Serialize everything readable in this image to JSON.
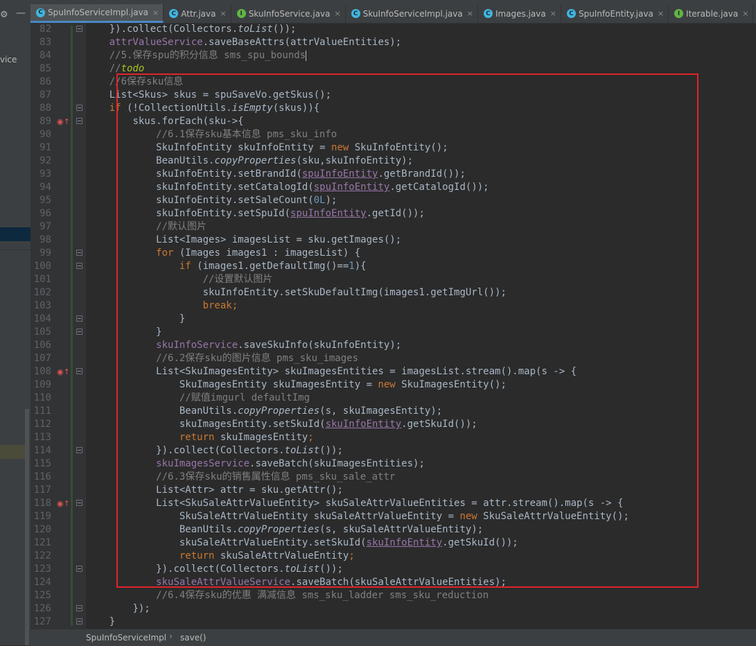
{
  "sidebar": {
    "visible_text": "vice"
  },
  "tabs": [
    {
      "label": "SpuInfoServiceImpl.java",
      "icon": "class-icon",
      "active": true,
      "closable": true
    },
    {
      "label": "Attr.java",
      "icon": "class-icon",
      "active": false,
      "closable": true
    },
    {
      "label": "SkuInfoService.java",
      "icon": "interface-icon",
      "active": false,
      "closable": true
    },
    {
      "label": "SkuInfoServiceImpl.java",
      "icon": "class-icon",
      "active": false,
      "closable": true
    },
    {
      "label": "Images.java",
      "icon": "class-icon",
      "active": false,
      "closable": true
    },
    {
      "label": "SpuInfoEntity.java",
      "icon": "class-icon",
      "active": false,
      "closable": true
    },
    {
      "label": "Iterable.java",
      "icon": "interface-icon",
      "active": false,
      "closable": true
    }
  ],
  "editor": {
    "lines": [
      {
        "n": "82",
        "indent": 4,
        "fold": true,
        "tokens": [
          [
            "}).collect(Collectors.",
            ""
          ],
          [
            "toList",
            "it"
          ],
          [
            "());",
            ""
          ]
        ]
      },
      {
        "n": "83",
        "indent": 4,
        "tokens": [
          [
            "attrValueService",
            "field"
          ],
          [
            ".saveBaseAttrs(attrValueEntities);",
            ""
          ]
        ]
      },
      {
        "n": "84",
        "indent": 4,
        "caret": true,
        "tokens": [
          [
            "//5.保存spu的积分信息 sms_spu_bounds",
            "cm"
          ]
        ]
      },
      {
        "n": "85",
        "indent": 4,
        "tokens": [
          [
            "//",
            "cm"
          ],
          [
            "todo",
            "todo"
          ]
        ]
      },
      {
        "n": "86",
        "indent": 4,
        "tokens": [
          [
            "//6保存sku信息",
            "cm"
          ]
        ]
      },
      {
        "n": "87",
        "indent": 4,
        "tokens": [
          [
            "List<Skus> skus = spuSaveVo.getSkus();",
            ""
          ]
        ]
      },
      {
        "n": "88",
        "indent": 4,
        "fold": true,
        "tokens": [
          [
            "if",
            "kw"
          ],
          [
            " (!CollectionUtils.",
            ""
          ],
          [
            "isEmpty",
            "it"
          ],
          [
            "(skus)){",
            ""
          ]
        ]
      },
      {
        "n": "89",
        "indent": 8,
        "icon": true,
        "fold": true,
        "tokens": [
          [
            "skus.forEach(sku->{",
            ""
          ]
        ]
      },
      {
        "n": "90",
        "indent": 12,
        "tokens": [
          [
            "//6.1保存sku基本信息 pms_sku_info",
            "cm"
          ]
        ]
      },
      {
        "n": "91",
        "indent": 12,
        "tokens": [
          [
            "SkuInfoEntity skuInfoEntity = ",
            ""
          ],
          [
            "new",
            "kw"
          ],
          [
            " SkuInfoEntity();",
            ""
          ]
        ]
      },
      {
        "n": "92",
        "indent": 12,
        "tokens": [
          [
            "BeanUtils.",
            ""
          ],
          [
            "copyProperties",
            "it"
          ],
          [
            "(sku,skuInfoEntity);",
            ""
          ]
        ]
      },
      {
        "n": "93",
        "indent": 12,
        "tokens": [
          [
            "skuInfoEntity.setBrandId(",
            ""
          ],
          [
            "spuInfoEntity",
            "ful"
          ],
          [
            ".getBrandId());",
            ""
          ]
        ]
      },
      {
        "n": "94",
        "indent": 12,
        "tokens": [
          [
            "skuInfoEntity.setCatalogId(",
            ""
          ],
          [
            "spuInfoEntity",
            "ful"
          ],
          [
            ".getCatalogId());",
            ""
          ]
        ]
      },
      {
        "n": "95",
        "indent": 12,
        "tokens": [
          [
            "skuInfoEntity.setSaleCount(",
            ""
          ],
          [
            "0L",
            "num"
          ],
          [
            ");",
            ""
          ]
        ]
      },
      {
        "n": "96",
        "indent": 12,
        "tokens": [
          [
            "skuInfoEntity.setSpuId(",
            ""
          ],
          [
            "spuInfoEntity",
            "ful"
          ],
          [
            ".getId());",
            ""
          ]
        ]
      },
      {
        "n": "97",
        "indent": 12,
        "tokens": [
          [
            "//默认图片",
            "cm"
          ]
        ]
      },
      {
        "n": "98",
        "indent": 12,
        "tokens": [
          [
            "List<Images> imagesList = sku.getImages();",
            ""
          ]
        ]
      },
      {
        "n": "99",
        "indent": 12,
        "fold": true,
        "tokens": [
          [
            "for",
            "kw"
          ],
          [
            " (Images images1 : imagesList) {",
            ""
          ]
        ]
      },
      {
        "n": "100",
        "indent": 16,
        "fold": true,
        "tokens": [
          [
            "if",
            "kw"
          ],
          [
            " (images1.getDefaultImg()==",
            ""
          ],
          [
            "1",
            "num"
          ],
          [
            "){",
            ""
          ]
        ]
      },
      {
        "n": "101",
        "indent": 20,
        "tokens": [
          [
            "//设置默认图片",
            "cm"
          ]
        ]
      },
      {
        "n": "102",
        "indent": 20,
        "tokens": [
          [
            "skuInfoEntity.setSkuDefaultImg(images1.getImgUrl());",
            ""
          ]
        ]
      },
      {
        "n": "103",
        "indent": 20,
        "tokens": [
          [
            "break;",
            "kw"
          ]
        ]
      },
      {
        "n": "104",
        "indent": 16,
        "fold": true,
        "tokens": [
          [
            "}",
            ""
          ]
        ]
      },
      {
        "n": "105",
        "indent": 12,
        "fold": true,
        "tokens": [
          [
            "}",
            ""
          ]
        ]
      },
      {
        "n": "106",
        "indent": 12,
        "tokens": [
          [
            "skuInfoService",
            "field"
          ],
          [
            ".saveSkuInfo(skuInfoEntity);",
            ""
          ]
        ]
      },
      {
        "n": "107",
        "indent": 12,
        "tokens": [
          [
            "//6.2保存sku的图片信息 pms_sku_images",
            "cm"
          ]
        ]
      },
      {
        "n": "108",
        "indent": 12,
        "icon": true,
        "fold": true,
        "tokens": [
          [
            "List<SkuImagesEntity> skuImagesEntities = imagesList.stream().map(s -> {",
            ""
          ]
        ]
      },
      {
        "n": "109",
        "indent": 16,
        "tokens": [
          [
            "SkuImagesEntity skuImagesEntity = ",
            ""
          ],
          [
            "new",
            "kw"
          ],
          [
            " SkuImagesEntity();",
            ""
          ]
        ]
      },
      {
        "n": "110",
        "indent": 16,
        "tokens": [
          [
            "//赋值imgurl defaultImg",
            "cm"
          ]
        ]
      },
      {
        "n": "111",
        "indent": 16,
        "tokens": [
          [
            "BeanUtils.",
            ""
          ],
          [
            "copyProperties",
            "it"
          ],
          [
            "(s, skuImagesEntity);",
            ""
          ]
        ]
      },
      {
        "n": "112",
        "indent": 16,
        "tokens": [
          [
            "skuImagesEntity.setSkuId(",
            ""
          ],
          [
            "skuInfoEntity",
            "ful"
          ],
          [
            ".getSkuId());",
            ""
          ]
        ]
      },
      {
        "n": "113",
        "indent": 16,
        "tokens": [
          [
            "return",
            "kw"
          ],
          [
            " skuImagesEntity",
            ""
          ],
          [
            ";",
            "kw"
          ]
        ]
      },
      {
        "n": "114",
        "indent": 12,
        "fold": true,
        "tokens": [
          [
            "}).collect(Collectors.",
            ""
          ],
          [
            "toList",
            "it"
          ],
          [
            "());",
            ""
          ]
        ]
      },
      {
        "n": "115",
        "indent": 12,
        "tokens": [
          [
            "skuImagesService",
            "field"
          ],
          [
            ".saveBatch(skuImagesEntities);",
            ""
          ]
        ]
      },
      {
        "n": "116",
        "indent": 12,
        "tokens": [
          [
            "//6.3保存sku的销售属性信息 pms_sku_sale_attr",
            "cm"
          ]
        ]
      },
      {
        "n": "117",
        "indent": 12,
        "tokens": [
          [
            "List<Attr> attr = sku.getAttr();",
            ""
          ]
        ]
      },
      {
        "n": "118",
        "indent": 12,
        "icon": true,
        "fold": true,
        "tokens": [
          [
            "List<SkuSaleAttrValueEntity> skuSaleAttrValueEntities = attr.stream().map(s -> {",
            ""
          ]
        ]
      },
      {
        "n": "119",
        "indent": 16,
        "tokens": [
          [
            "SkuSaleAttrValueEntity skuSaleAttrValueEntity = ",
            ""
          ],
          [
            "new",
            "kw"
          ],
          [
            " SkuSaleAttrValueEntity();",
            ""
          ]
        ]
      },
      {
        "n": "120",
        "indent": 16,
        "tokens": [
          [
            "BeanUtils.",
            ""
          ],
          [
            "copyProperties",
            "it"
          ],
          [
            "(s, skuSaleAttrValueEntity);",
            ""
          ]
        ]
      },
      {
        "n": "121",
        "indent": 16,
        "tokens": [
          [
            "skuSaleAttrValueEntity.setSkuId(",
            ""
          ],
          [
            "skuInfoEntity",
            "ful"
          ],
          [
            ".getSkuId());",
            ""
          ]
        ]
      },
      {
        "n": "122",
        "indent": 16,
        "tokens": [
          [
            "return",
            "kw"
          ],
          [
            " skuSaleAttrValueEntity",
            ""
          ],
          [
            ";",
            "kw"
          ]
        ]
      },
      {
        "n": "123",
        "indent": 12,
        "fold": true,
        "tokens": [
          [
            "}).collect(Collectors.",
            ""
          ],
          [
            "toList",
            "it"
          ],
          [
            "());",
            ""
          ]
        ]
      },
      {
        "n": "124",
        "indent": 12,
        "tokens": [
          [
            "skuSaleAttrValueService",
            "field"
          ],
          [
            ".saveBatch(skuSaleAttrValueEntities);",
            ""
          ]
        ]
      },
      {
        "n": "125",
        "indent": 12,
        "tokens": [
          [
            "//6.4保存sku的优惠 满减信息 sms_sku_ladder sms_sku_reduction",
            "cm"
          ]
        ]
      },
      {
        "n": "126",
        "indent": 8,
        "fold": true,
        "tokens": [
          [
            "});",
            ""
          ]
        ]
      },
      {
        "n": "127",
        "indent": 4,
        "fold": true,
        "tokens": [
          [
            "}",
            ""
          ]
        ]
      }
    ]
  },
  "breadcrumb": {
    "class_name": "SpuInfoServiceImpl",
    "method_name": "save()"
  },
  "colors": {
    "editor_bg": "#2b2b2b",
    "gutter_bg": "#313335",
    "keyword": "#cc7832",
    "comment": "#808080",
    "field": "#9876aa",
    "number": "#6897bb",
    "todo": "#a8c023",
    "text": "#a9b7c6",
    "highlight_box": "#e0242b"
  }
}
